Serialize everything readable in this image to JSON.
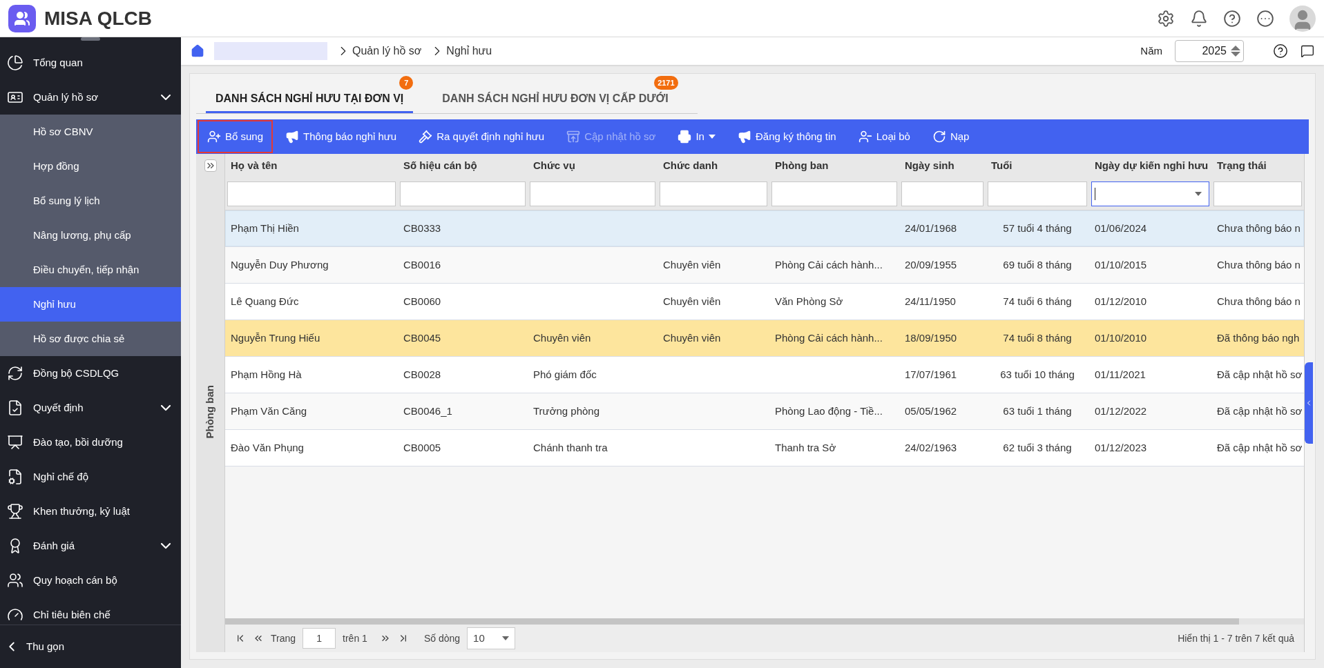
{
  "app": {
    "title": "MISA QLCB"
  },
  "breadcrumb": {
    "items": [
      "Quản lý hồ sơ",
      "Nghỉ hưu"
    ]
  },
  "year": {
    "label": "Năm",
    "value": "2025"
  },
  "sidebar": {
    "items": [
      {
        "label": "Tổng quan",
        "kind": "link",
        "selected": false
      },
      {
        "label": "Quản lý hồ sơ",
        "kind": "group",
        "expanded": true,
        "selected": false,
        "children": [
          {
            "label": "Hồ sơ CBNV",
            "selected": false
          },
          {
            "label": "Hợp đồng",
            "selected": false
          },
          {
            "label": "Bổ sung lý lịch",
            "selected": false
          },
          {
            "label": "Nâng lương, phụ cấp",
            "selected": false
          },
          {
            "label": "Điều chuyển, tiếp nhận",
            "selected": false
          },
          {
            "label": "Nghỉ hưu",
            "selected": true
          },
          {
            "label": "Hồ sơ được chia sẻ",
            "selected": false
          }
        ]
      },
      {
        "label": "Đồng bộ CSDLQG",
        "kind": "link",
        "selected": false
      },
      {
        "label": "Quyết định",
        "kind": "group",
        "expanded": false,
        "selected": false
      },
      {
        "label": "Đào tạo, bồi dưỡng",
        "kind": "link",
        "selected": false
      },
      {
        "label": "Nghỉ chế độ",
        "kind": "link",
        "selected": false
      },
      {
        "label": "Khen thưởng, kỷ luật",
        "kind": "link",
        "selected": false
      },
      {
        "label": "Đánh giá",
        "kind": "group",
        "expanded": false,
        "selected": false
      },
      {
        "label": "Quy hoạch cán bộ",
        "kind": "link",
        "selected": false
      },
      {
        "label": "Chỉ tiêu biên chế",
        "kind": "link",
        "selected": false
      }
    ],
    "collapse_label": "Thu gọn"
  },
  "tabs": [
    {
      "label": "DANH SÁCH NGHỈ HƯU TẠI ĐƠN VỊ",
      "badge": "7",
      "selected": true
    },
    {
      "label": "DANH SÁCH NGHỈ HƯU ĐƠN VỊ CẤP DƯỚI",
      "badge": "2171",
      "selected": false
    }
  ],
  "toolbar": [
    {
      "label": "Bổ sung",
      "disabled": false,
      "outlined": true,
      "menu": false
    },
    {
      "label": "Thông báo nghỉ hưu",
      "disabled": false,
      "outlined": false,
      "menu": false
    },
    {
      "label": "Ra quyết định nghỉ hưu",
      "disabled": false,
      "outlined": false,
      "menu": false
    },
    {
      "label": "Cập nhật hồ sơ",
      "disabled": true,
      "outlined": false,
      "menu": false
    },
    {
      "label": "In",
      "disabled": false,
      "outlined": false,
      "menu": true
    },
    {
      "label": "Đăng ký thông tin",
      "disabled": false,
      "outlined": false,
      "menu": false
    },
    {
      "label": "Loại bỏ",
      "disabled": false,
      "outlined": false,
      "menu": false
    },
    {
      "label": "Nạp",
      "disabled": false,
      "outlined": false,
      "menu": false
    }
  ],
  "side_panel": {
    "label": "Phòng ban"
  },
  "table": {
    "columns": [
      {
        "label": "Họ và tên",
        "kind": "text",
        "focused": false
      },
      {
        "label": "Số hiệu cán bộ",
        "kind": "text",
        "focused": false
      },
      {
        "label": "Chức vụ",
        "kind": "text",
        "focused": false
      },
      {
        "label": "Chức danh",
        "kind": "text",
        "focused": false
      },
      {
        "label": "Phòng ban",
        "kind": "text",
        "focused": false
      },
      {
        "label": "Ngày sinh",
        "kind": "text",
        "focused": false
      },
      {
        "label": "Tuổi",
        "kind": "text",
        "focused": false
      },
      {
        "label": "Ngày dự kiến nghỉ hưu",
        "kind": "select",
        "focused": true
      },
      {
        "label": "Trạng thái",
        "kind": "text",
        "focused": false
      }
    ],
    "rows": [
      {
        "cells": [
          "Phạm Thị Hiền",
          "CB0333",
          null,
          null,
          null,
          "24/01/1968",
          "57 tuổi 4 tháng",
          "01/06/2024",
          "Chưa thông báo n"
        ],
        "selected": true,
        "highlighted": false
      },
      {
        "cells": [
          "Nguyễn Duy Phương",
          "CB0016",
          null,
          "Chuyên viên",
          "Phòng Cải cách hành...",
          "20/09/1955",
          "69 tuổi 8 tháng",
          "01/10/2015",
          "Chưa thông báo n"
        ],
        "selected": false,
        "highlighted": false
      },
      {
        "cells": [
          "Lê Quang Đức",
          "CB0060",
          null,
          "Chuyên viên",
          "Văn Phòng Sở",
          "24/11/1950",
          "74 tuổi 6 tháng",
          "01/12/2010",
          "Chưa thông báo n"
        ],
        "selected": false,
        "highlighted": false
      },
      {
        "cells": [
          "Nguyễn Trung Hiếu",
          "CB0045",
          "Chuyên viên",
          "Chuyên viên",
          "Phòng Cải cách hành...",
          "18/09/1950",
          "74 tuổi 8 tháng",
          "01/10/2010",
          "Đã thông báo ngh"
        ],
        "selected": false,
        "highlighted": true
      },
      {
        "cells": [
          "Phạm Hồng Hà",
          "CB0028",
          "Phó giám đốc",
          null,
          null,
          "17/07/1961",
          "63 tuổi 10 tháng",
          "01/11/2021",
          "Đã cập nhật hồ sơ"
        ],
        "selected": false,
        "highlighted": false
      },
      {
        "cells": [
          "Phạm Văn Căng",
          "CB0046_1",
          "Trưởng phòng",
          null,
          "Phòng Lao động - Tiề...",
          "05/05/1962",
          "63 tuổi 1 tháng",
          "01/12/2022",
          "Đã cập nhật hồ sơ"
        ],
        "selected": false,
        "highlighted": false
      },
      {
        "cells": [
          "Đào Văn Phụng",
          "CB0005",
          "Chánh thanh tra",
          null,
          "Thanh tra Sở",
          "24/02/1963",
          "62 tuổi 3 tháng",
          "01/12/2023",
          "Đã cập nhật hồ sơ"
        ],
        "selected": false,
        "highlighted": false
      }
    ]
  },
  "pagination": {
    "page_label": "Trang",
    "page": "1",
    "of_label": "trên 1",
    "rows_label": "Số dòng",
    "rows_per_page": "10",
    "summary": "Hiển thị 1 - 7 trên 7 kết quả"
  }
}
